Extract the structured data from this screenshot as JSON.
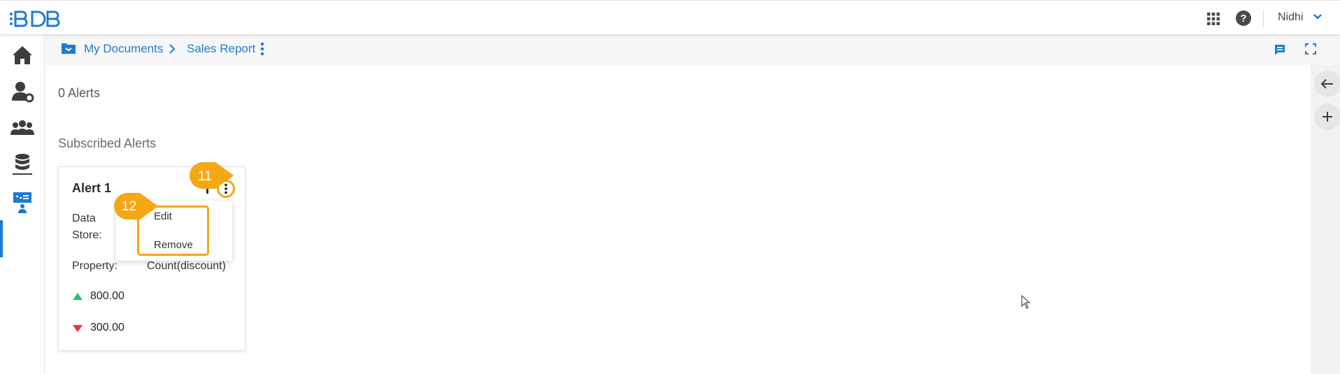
{
  "header": {
    "logo_text": "BDB",
    "apps_icon": "apps-grid-icon",
    "help_icon": "help-icon",
    "user_name": "Nidhi"
  },
  "sidebar": {
    "items": [
      {
        "name": "home",
        "icon": "home-icon"
      },
      {
        "name": "user-settings",
        "icon": "user-gear-icon"
      },
      {
        "name": "users-groups",
        "icon": "users-group-icon"
      },
      {
        "name": "data-store",
        "icon": "database-icon"
      },
      {
        "name": "alerts",
        "icon": "presentation-user-icon",
        "active": true
      }
    ]
  },
  "breadcrumb": {
    "items": [
      "My Documents",
      "Sales Report"
    ]
  },
  "main": {
    "alerts_count": "0 Alerts",
    "section_title": "Subscribed Alerts",
    "card": {
      "title": "Alert 1",
      "data_store_label_line1": "Data",
      "data_store_label_line2": "Store:",
      "property_label": "Property:",
      "property_value": "Count(discount)",
      "upper_value": "800.00",
      "lower_value": "300.00"
    },
    "menu": {
      "items": [
        "Edit",
        "Remove"
      ]
    }
  },
  "callouts": [
    "11",
    "12"
  ],
  "colors": {
    "accent": "#1f7bd1",
    "callout": "#f5a714",
    "up": "#25c16f",
    "down": "#e8343b"
  }
}
